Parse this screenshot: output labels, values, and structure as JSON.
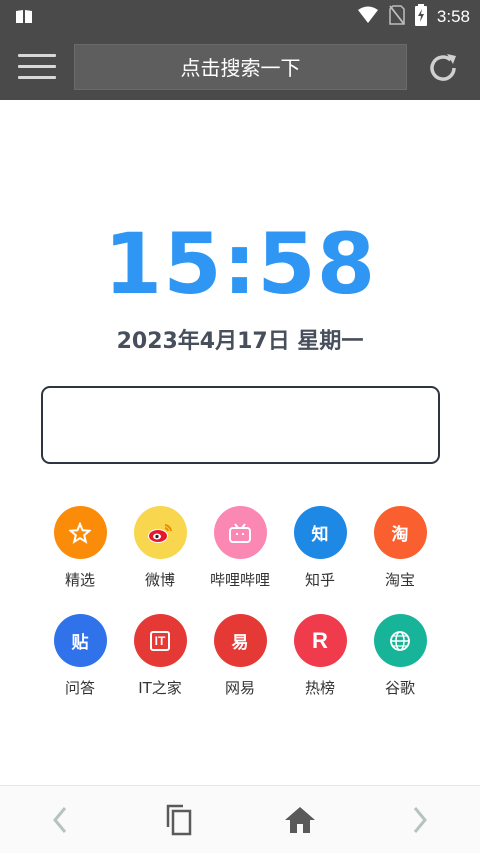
{
  "status_bar": {
    "time": "3:58",
    "icons": [
      "book-icon",
      "wifi-icon",
      "no-sim-icon",
      "battery-charging-icon"
    ]
  },
  "top_bar": {
    "menu_icon": "menu-icon",
    "search_placeholder": "点击搜索一下",
    "refresh_icon": "refresh-icon"
  },
  "clock": {
    "time": "15:58",
    "date": "2023年4月17日 星期一"
  },
  "shortcuts": [
    {
      "label": "精选",
      "glyph": "☆",
      "color": "#fb8c0a"
    },
    {
      "label": "微博",
      "glyph": "",
      "color": "#f8d64e"
    },
    {
      "label": "哔哩哔哩",
      "glyph": "",
      "color": "#fb88b3"
    },
    {
      "label": "知乎",
      "glyph": "知",
      "color": "#1e88e5"
    },
    {
      "label": "淘宝",
      "glyph": "淘",
      "color": "#f95f2f"
    },
    {
      "label": "问答",
      "glyph": "贴",
      "color": "#2f72ea"
    },
    {
      "label": "IT之家",
      "glyph": "IT",
      "color": "#e53935"
    },
    {
      "label": "网易",
      "glyph": "易",
      "color": "#e53935"
    },
    {
      "label": "热榜",
      "glyph": "R",
      "color": "#ef3b4b"
    },
    {
      "label": "谷歌",
      "glyph": "",
      "color": "#17b49a"
    }
  ],
  "bottom_nav": {
    "icons": [
      "back-icon",
      "tabs-icon",
      "home-icon",
      "forward-icon"
    ]
  }
}
